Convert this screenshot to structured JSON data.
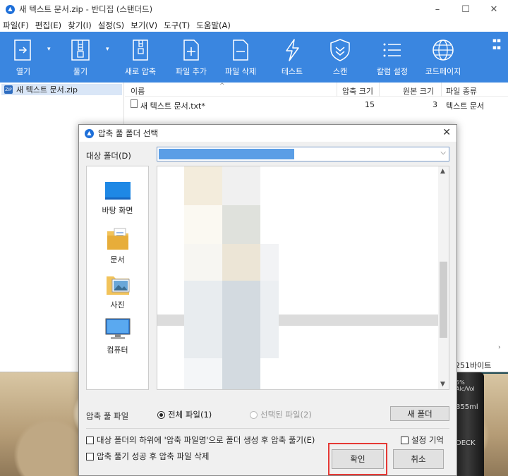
{
  "window": {
    "title": "새 텍스트 문서.zip - 반디집 (스탠더드)",
    "controls": [
      "–",
      "☐",
      "✕"
    ]
  },
  "menu": [
    "파일(F)",
    "편집(E)",
    "찾기(I)",
    "설정(S)",
    "보기(V)",
    "도구(T)",
    "도움말(A)"
  ],
  "toolbar": {
    "background": "#3a86e0",
    "buttons": [
      {
        "label": "열기",
        "icon": "open-icon"
      },
      {
        "label": "풀기",
        "icon": "extract-icon"
      },
      {
        "label": "새로 압축",
        "icon": "new-archive-icon"
      },
      {
        "label": "파일 추가",
        "icon": "add-file-icon"
      },
      {
        "label": "파일 삭제",
        "icon": "delete-file-icon"
      },
      {
        "label": "테스트",
        "icon": "test-icon"
      },
      {
        "label": "스캔",
        "icon": "scan-icon"
      },
      {
        "label": "칼럼 설정",
        "icon": "columns-icon"
      },
      {
        "label": "코드페이지",
        "icon": "codepage-icon"
      }
    ]
  },
  "tree": {
    "item": "새 텍스트 문서.zip"
  },
  "list": {
    "columns": [
      "이름",
      "압축 크기",
      "원본 크기",
      "파일 종류"
    ],
    "rows": [
      {
        "name": "새 텍스트 문서.txt*",
        "compressed": "15",
        "original": "3",
        "type": "텍스트 문서"
      }
    ]
  },
  "status": {
    "size_text": "251바이트"
  },
  "dialog": {
    "title": "압축 풀 폴더 선택",
    "dest_label": "대상 폴더(D)",
    "places": [
      "바탕 화면",
      "문서",
      "사진",
      "컴퓨터"
    ],
    "extract_files_label": "압축 풀 파일",
    "radio_all": "전체 파일(1)",
    "radio_selected": "선택된 파일(2)",
    "new_folder": "새 폴더",
    "chk_subfolder": "대상 폴더의 하위에 '압축 파일명'으로 폴더 생성 후 압축 풀기(E)",
    "chk_delete": "압축 풀기 성공 후 압축 파일 삭제",
    "chk_remember": "설정 기억",
    "ok": "확인",
    "cancel": "취소"
  },
  "desktop": {
    "bottle_text": [
      "5% Alc/Vol",
      "355ml",
      "DECK"
    ]
  }
}
